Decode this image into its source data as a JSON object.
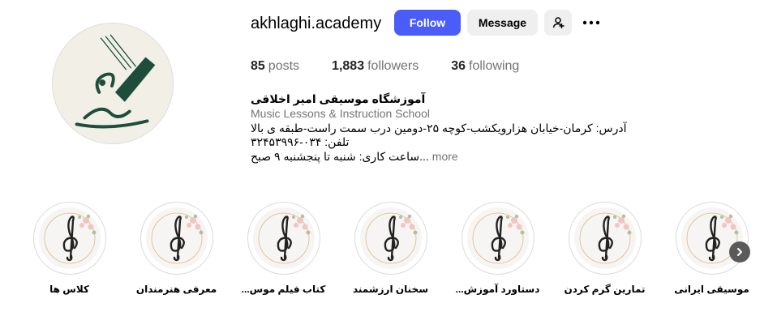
{
  "profile": {
    "username": "akhlaghi.academy",
    "avatar_icon": "music-school-logo",
    "brand_color": "#1e4d3c"
  },
  "actions": {
    "follow_label": "Follow",
    "message_label": "Message",
    "add_user_icon": "person-add-icon",
    "more_icon": "more-horizontal-icon",
    "follow_color": "#4a5df9"
  },
  "stats": {
    "posts_count": "85",
    "posts_label": "posts",
    "followers_count": "1,883",
    "followers_label": "followers",
    "following_count": "36",
    "following_label": "following"
  },
  "bio": {
    "name": "آموزشگاه موسیقی امیر اخلاقی",
    "category": "Music Lessons & Instruction School",
    "line1": "آدرس: کرمان-خیابان هزارویکشب-کوچه ۲۵-دومین درب سمت راست-طبقه ی بالا",
    "line2": "تلفن: ۰۳۴-۳۲۴۵۳۹۹۶",
    "line3": "...ساعت کاری: شنبه تا پنجشنبه ۹ صبح",
    "more_label": "more"
  },
  "highlights": [
    {
      "label": "کلاس ها"
    },
    {
      "label": "معرفی هنرمندان"
    },
    {
      "label": "کتاب فیلم موس..."
    },
    {
      "label": "سخنان ارزشمند"
    },
    {
      "label": "دستاورد آموزش..."
    },
    {
      "label": "تمارین گرم کردن"
    },
    {
      "label": "موسیقی ایرانی"
    }
  ],
  "highlight_icon": "treble-clef-icon",
  "next_icon": "chevron-right-icon"
}
